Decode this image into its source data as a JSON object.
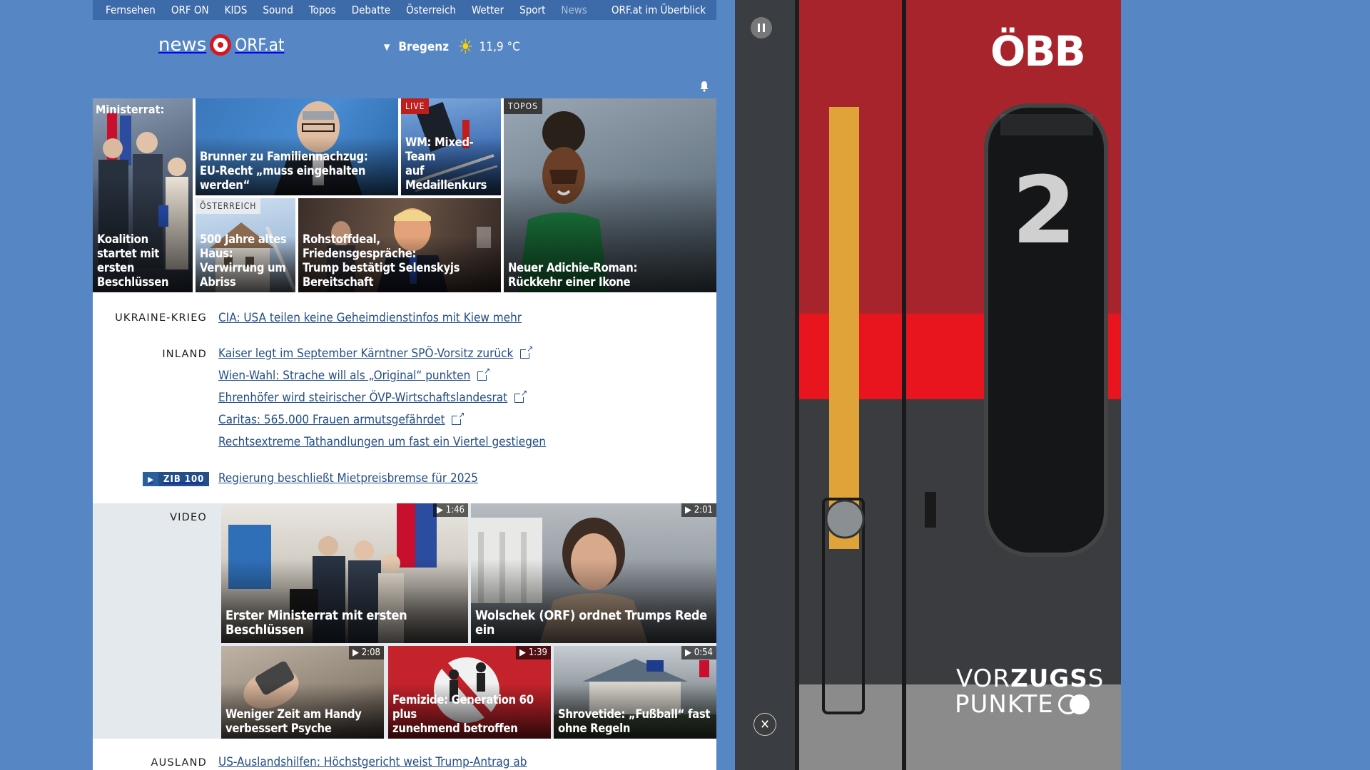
{
  "topnav": [
    {
      "label": "Fernsehen",
      "dim": false
    },
    {
      "label": "ORF ON",
      "dim": false
    },
    {
      "label": "KIDS",
      "dim": false
    },
    {
      "label": "Sound",
      "dim": false
    },
    {
      "label": "Topos",
      "dim": false
    },
    {
      "label": "Debatte",
      "dim": false
    },
    {
      "label": "Österreich",
      "dim": false
    },
    {
      "label": "Wetter",
      "dim": false
    },
    {
      "label": "Sport",
      "dim": false
    },
    {
      "label": "News",
      "dim": true
    }
  ],
  "topnav_overview": "ORF.at im Überblick",
  "logo": {
    "news": "news",
    "orf": "ORF.at"
  },
  "weather": {
    "location": "Bregenz",
    "temperature": "11,9 °C"
  },
  "colors": {
    "background": "#5686c4",
    "nav": "#3d6aa8",
    "link": "#234e86",
    "live": "#c21d1d",
    "orf_red": "#d7161e"
  },
  "top_tiles": [
    {
      "kicker": "Ministerrat:",
      "badge": "",
      "lines": [
        "Koalition startet mit",
        "ersten Beschlüssen"
      ]
    },
    {
      "kicker": "",
      "badge": "",
      "lines": [
        "Brunner zu Familiennachzug:",
        "EU-Recht „muss eingehalten werden“"
      ]
    },
    {
      "kicker": "",
      "badge": "LIVE",
      "lines": [
        "WM: Mixed-Team",
        "auf Medaillenkurs"
      ]
    },
    {
      "kicker": "",
      "badge": "TOPOS",
      "lines": [
        "Neuer Adichie-Roman:",
        "Rückkehr einer Ikone"
      ]
    },
    {
      "kicker": "",
      "badge": "ÖSTERREICH",
      "lines": [
        "500 Jahre altes Haus:",
        "Verwirrung um Abriss"
      ]
    },
    {
      "kicker": "",
      "badge": "",
      "lines": [
        "Rohstoffdeal, Friedensgespräche:",
        "Trump bestätigt Selenskyjs Bereitschaft"
      ]
    }
  ],
  "sections": {
    "ukraine": {
      "label": "UKRAINE-KRIEG",
      "headline": "CIA: USA teilen keine Geheimdienstinfos mit Kiew mehr"
    },
    "inland": {
      "label": "INLAND",
      "headlines": [
        {
          "text": "Kaiser legt im September Kärntner SPÖ-Vorsitz zurück",
          "external": true
        },
        {
          "text": "Wien-Wahl: Strache will als „Original“ punkten",
          "external": true
        },
        {
          "text": "Ehrenhöfer wird steirischer ÖVP-Wirtschaftslandesrat",
          "external": true
        },
        {
          "text": "Caritas: 565.000 Frauen armutsgefährdet",
          "external": true
        },
        {
          "text": "Rechtsextreme Tathandlungen um fast ein Viertel gestiegen",
          "external": false
        }
      ]
    },
    "zib": {
      "play": "▶",
      "label": "ZIB 100",
      "headline": "Regierung beschließt Mietpreisbremse für 2025"
    },
    "video": {
      "label": "VIDEO"
    },
    "ausland": {
      "label": "AUSLAND",
      "headline": "US-Auslandshilfen: Höchstgericht weist Trump-Antrag ab"
    }
  },
  "videos": [
    {
      "duration": "▶ 1:46",
      "lines": [
        "Erster Ministerrat mit ersten Beschlüssen"
      ]
    },
    {
      "duration": "▶ 2:01",
      "lines": [
        "Wolschek (ORF) ordnet Trumps Rede ein"
      ]
    },
    {
      "duration": "▶ 2:08",
      "lines": [
        "Weniger Zeit am Handy",
        "verbessert Psyche"
      ]
    },
    {
      "duration": "▶ 1:39",
      "lines": [
        "Femizide: Generation 60 plus",
        "zunehmend betroffen"
      ]
    },
    {
      "duration": "▶ 0:54",
      "lines": [
        "Shrovetide: „Fußball“ fast",
        "ohne Regeln"
      ]
    }
  ],
  "ad": {
    "logo": "ÖBB",
    "text_bold": "ZUGS",
    "text_pre": "VOR",
    "text_end": "S",
    "line2": "PUNKTE",
    "number": "2"
  }
}
